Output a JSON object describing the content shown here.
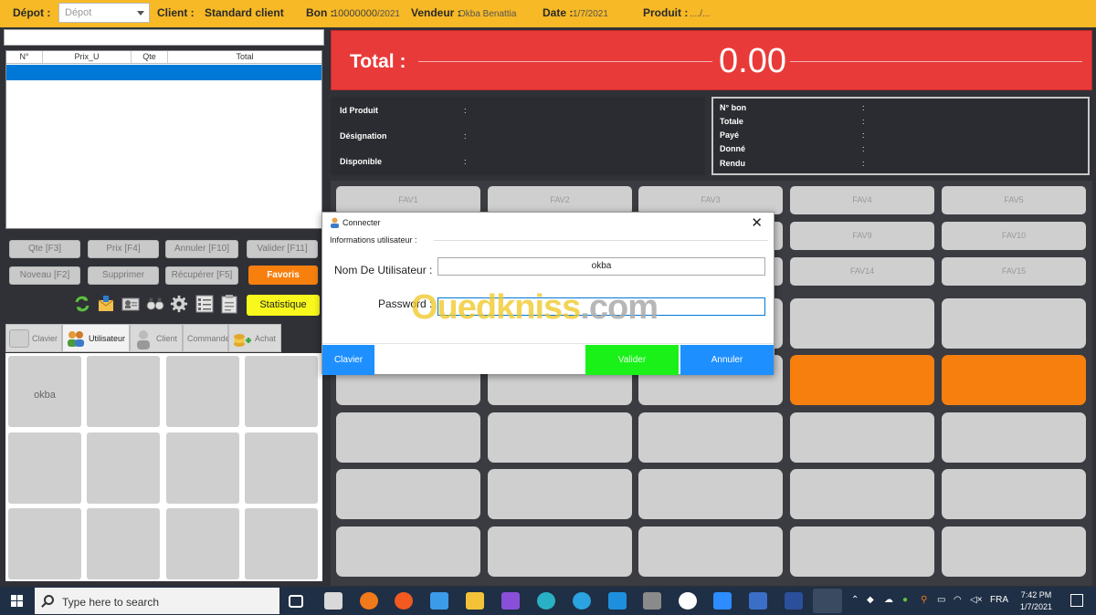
{
  "header": {
    "depot_label": "Dépot :",
    "depot_value": "Dépot",
    "client_label": "Client :",
    "client_value": "Standard client",
    "bon_label": "Bon :",
    "bon_number": "10000000",
    "bon_year": "/2021",
    "vendeur_label": "Vendeur :",
    "vendeur_value": "Okba Benattia",
    "date_label": "Date :",
    "date_value": "1/7/2021",
    "produit_label": "Produit :",
    "produit_value": "..../..."
  },
  "table": {
    "columns": [
      "N°",
      "Prix_U",
      "Qte",
      "Total"
    ]
  },
  "actions": {
    "qte": "Qte [F3]",
    "prix": "Prix [F4]",
    "annuler": "Annuler [F10]",
    "valider": "Valider [F11]",
    "nouveau": "Noveau [F2]",
    "supprimer": "Supprimer",
    "recuperer": "Récupérer [F5]",
    "favoris": "Favoris",
    "statistique": "Statistique"
  },
  "tabs": [
    {
      "label": "Clavier"
    },
    {
      "label": "Utilisateur"
    },
    {
      "label": "Client"
    },
    {
      "label": "Commande"
    },
    {
      "label": "Achat"
    }
  ],
  "users": {
    "first": "okba"
  },
  "total": {
    "label": "Total :",
    "value": "0.00"
  },
  "product_info": {
    "id_label": "Id Produit",
    "designation_label": "Désignation",
    "disponible_label": "Disponible",
    "colon": ":"
  },
  "bon_info": {
    "n_bon_label": "N° bon",
    "totale_label": "Totale",
    "paye_label": "Payé",
    "donne_label": "Donné",
    "rendu_label": "Rendu"
  },
  "favorites": [
    "FAV1",
    "FAV2",
    "FAV3",
    "FAV4",
    "FAV5",
    "FAV9",
    "FAV10",
    "FAV14",
    "FAV15"
  ],
  "dialog": {
    "title": "Connecter",
    "section": "Informations utilisateur :",
    "username_label": "Nom De Utilisateur :",
    "username_value": "okba",
    "password_label": "Password :",
    "clavier": "Clavier",
    "valider": "Valider",
    "annuler": "Annuler"
  },
  "watermark": {
    "brand": "Ouedkniss",
    "suffix": ".com"
  },
  "taskbar": {
    "search_placeholder": "Type here to search",
    "language": "FRA",
    "time": "7:42 PM",
    "date": "1/7/2021"
  },
  "colors": {
    "topbar": "#f7b925",
    "total_banner": "#e93a3a",
    "accent_orange": "#f77f0e",
    "statistique_yellow": "#f8f81c",
    "valider_green": "#19f119",
    "dialog_blue": "#1e8fff",
    "taskbar": "#1f2f45"
  }
}
